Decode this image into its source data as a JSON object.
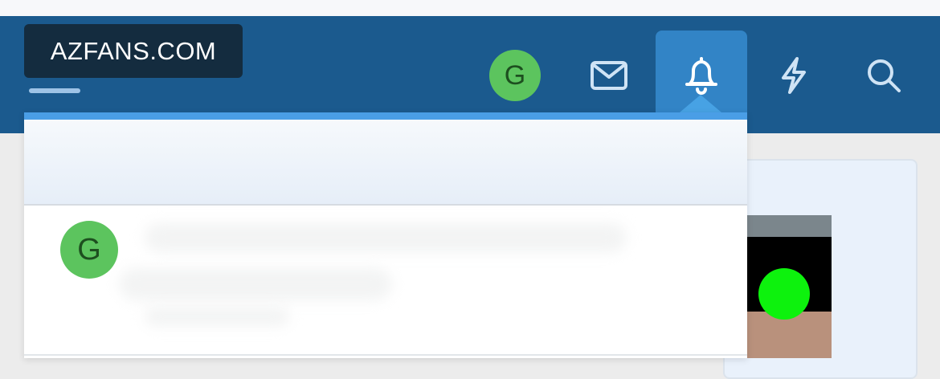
{
  "site": {
    "name": "AZFANS.COM"
  },
  "nav": {
    "avatar_initial": "G",
    "icons": [
      "inbox-icon",
      "bell-icon",
      "bolt-icon",
      "search-icon"
    ]
  },
  "notifications": {
    "items": [
      {
        "avatar_initial": "G"
      }
    ]
  },
  "colors": {
    "nav_bg": "#1b5a8e",
    "active_tab": "#3284c6",
    "avatar_bg": "#5cc45e",
    "dropdown_accent": "#4a9ee6"
  }
}
